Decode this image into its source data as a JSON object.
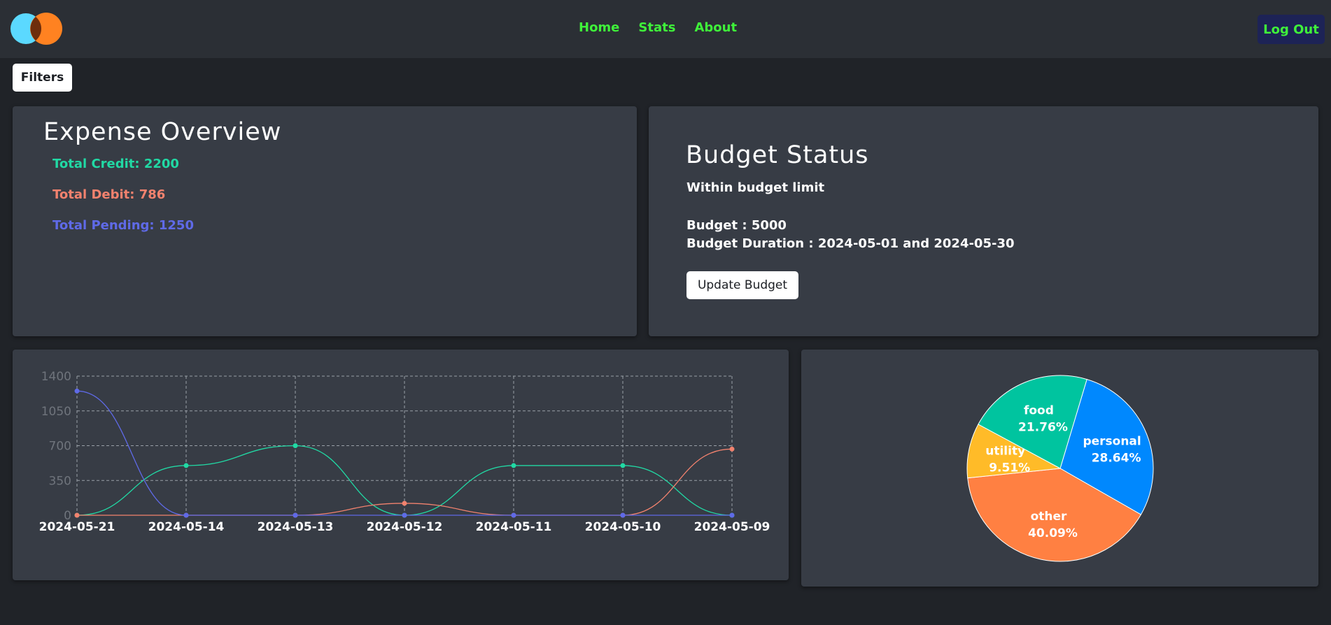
{
  "nav": {
    "links": [
      "Home",
      "Stats",
      "About"
    ],
    "logout_label": "Log Out"
  },
  "filters_label": "Filters",
  "overview": {
    "title": "Expense Overview",
    "credit": "Total Credit: 2200",
    "debit": "Total Debit: 786",
    "pending": "Total Pending: 1250"
  },
  "budget": {
    "title": "Budget Status",
    "status": "Within budget limit",
    "amount": "Budget : 5000",
    "duration": "Budget Duration : 2024-05-01 and 2024-05-30",
    "update_label": "Update Budget"
  },
  "colors": {
    "accent_green": "#3ff23a",
    "credit": "#21d9a4",
    "debit": "#f2826e",
    "pending": "#5f6ae8",
    "card_bg": "#373c45"
  },
  "chart_data": [
    {
      "type": "line",
      "x": [
        "2024-05-21",
        "2024-05-14",
        "2024-05-13",
        "2024-05-12",
        "2024-05-11",
        "2024-05-10",
        "2024-05-09"
      ],
      "y_ticks": [
        "0",
        "350",
        "700",
        "1050",
        "1400"
      ],
      "ylim": [
        0,
        1400
      ],
      "grid": true,
      "series": [
        {
          "values": [
            0,
            500,
            700,
            0,
            500,
            500,
            0
          ],
          "color": "#21d9a4"
        },
        {
          "values": [
            0,
            0,
            0,
            120,
            0,
            0,
            666
          ],
          "color": "#f2826e"
        },
        {
          "values": [
            1250,
            0,
            0,
            0,
            0,
            0,
            0
          ],
          "color": "#5f6ae8"
        }
      ]
    },
    {
      "type": "pie",
      "slices": [
        {
          "label": "personal",
          "percent": "28.64%",
          "value": 28.64,
          "color": "#0088fe"
        },
        {
          "label": "other",
          "percent": "40.09%",
          "value": 40.09,
          "color": "#ff8042"
        },
        {
          "label": "utility",
          "percent": "9.51%",
          "value": 9.51,
          "color": "#ffbb28"
        },
        {
          "label": "food",
          "percent": "21.76%",
          "value": 21.76,
          "color": "#00c49f"
        }
      ]
    }
  ]
}
